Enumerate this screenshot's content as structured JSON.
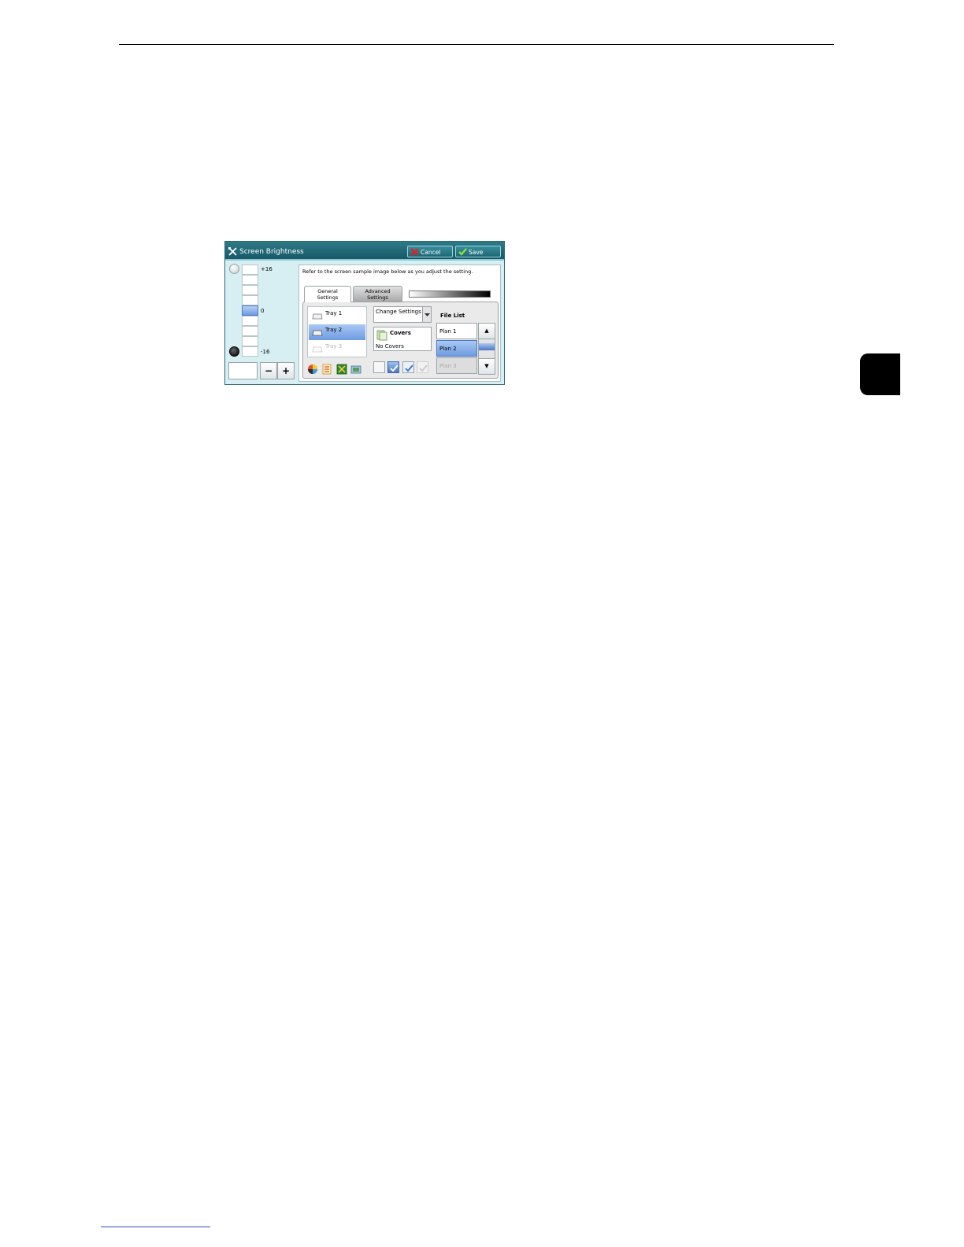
{
  "dialog": {
    "title": "Screen Brightness",
    "cancel_label": "Cancel",
    "save_label": "Save",
    "level_max_label": "+16",
    "level_mid_label": "0",
    "level_min_label": "-16",
    "level_value": "",
    "minus_label": "−",
    "plus_label": "+"
  },
  "sample": {
    "caption": "Refer to the screen sample image below as you adjust the setting.",
    "tabs": [
      {
        "label_line1": "General",
        "label_line2": "Settings"
      },
      {
        "label_line1": "Advanced",
        "label_line2": "Settings"
      }
    ],
    "trays": [
      {
        "label": "Tray 1"
      },
      {
        "label": "Tray 2"
      },
      {
        "label": "Tray 3"
      }
    ],
    "change_settings_label": "Change Settings",
    "covers_title": "Covers",
    "covers_value": "No Covers",
    "file_list_label": "File List",
    "files": [
      {
        "label": "Plan 1"
      },
      {
        "label": "Plan 2"
      },
      {
        "label": "Plan 3"
      }
    ],
    "scroll_up": "▲",
    "scroll_down": "▼"
  }
}
